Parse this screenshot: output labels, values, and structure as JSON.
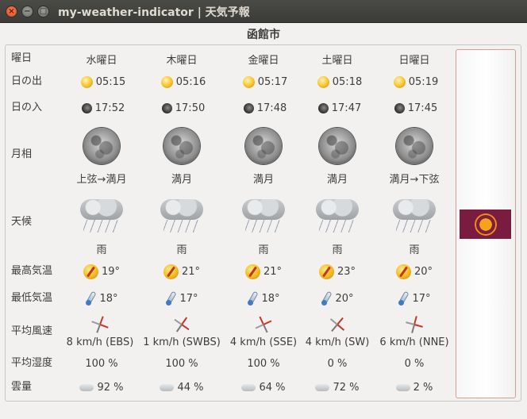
{
  "window": {
    "title": "my-weather-indicator | 天気予報",
    "close_glyph": "×",
    "min_glyph": "−",
    "max_glyph": "□"
  },
  "city": "函館市",
  "labels": {
    "day": "曜日",
    "sunrise": "日の出",
    "sunset": "日の入",
    "moon_phase": "月相",
    "weather": "天候",
    "high": "最高気温",
    "low": "最低気温",
    "wind": "平均風速",
    "humidity": "平均湿度",
    "cloud": "雲量"
  },
  "days": [
    {
      "name": "水曜日",
      "sunrise": "05:15",
      "sunset": "17:52",
      "moon": "上弦→満月",
      "weather": "雨",
      "high": "19°",
      "low": "18°",
      "wind": "8 km/h (EBS)",
      "humidity": "100 %",
      "cloud": "92 %"
    },
    {
      "name": "木曜日",
      "sunrise": "05:16",
      "sunset": "17:50",
      "moon": "満月",
      "weather": "雨",
      "high": "21°",
      "low": "17°",
      "wind": "1 km/h (SWBS)",
      "humidity": "100 %",
      "cloud": "44 %"
    },
    {
      "name": "金曜日",
      "sunrise": "05:17",
      "sunset": "17:48",
      "moon": "満月",
      "weather": "雨",
      "high": "21°",
      "low": "18°",
      "wind": "4 km/h (SSE)",
      "humidity": "100 %",
      "cloud": "64 %"
    },
    {
      "name": "土曜日",
      "sunrise": "05:18",
      "sunset": "17:47",
      "moon": "満月",
      "weather": "雨",
      "high": "23°",
      "low": "20°",
      "wind": "4 km/h (SW)",
      "humidity": "0 %",
      "cloud": "72 %"
    },
    {
      "name": "日曜日",
      "sunrise": "05:19",
      "sunset": "17:45",
      "moon": "満月→下弦",
      "weather": "雨",
      "high": "20°",
      "low": "17°",
      "wind": "6 km/h (NNE)",
      "humidity": "0 %",
      "cloud": "2 %"
    }
  ],
  "icons": {
    "sunrise": "sun-icon",
    "sunset": "moon-small-icon",
    "moon": "full-moon-icon",
    "weather": "rain-cloud-icon",
    "high": "thermometer-hot-icon",
    "low": "thermometer-cold-icon",
    "wind": "wind-compass-icon",
    "cloud": "cloud-icon",
    "provider": "provider-logo-icon"
  },
  "colors": {
    "titlebar": "#3c3b37",
    "close_button": "#e9541f",
    "provider_bg": "#7a1b40",
    "provider_sun": "#f6a21c"
  }
}
